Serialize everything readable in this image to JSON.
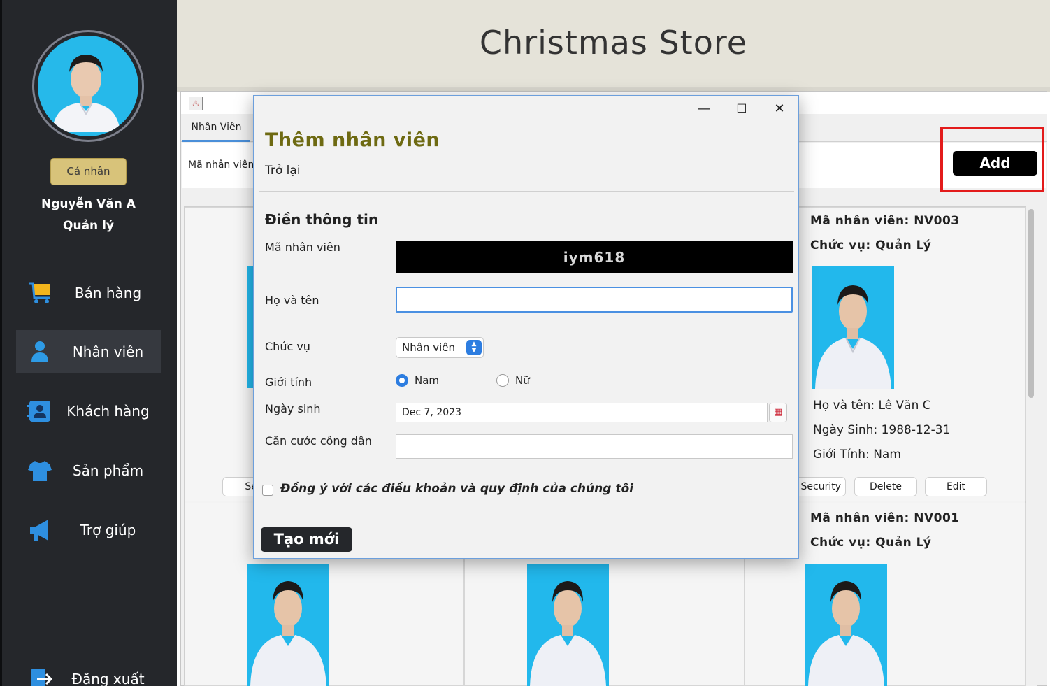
{
  "header": {
    "title": "Christmas Store"
  },
  "sidebar": {
    "profile_button": "Cá nhân",
    "user_name": "Nguyễn Văn A",
    "user_role": "Quản lý",
    "items": [
      {
        "label": "Bán hàng",
        "icon": "cart-icon"
      },
      {
        "label": "Nhân viên",
        "icon": "person-icon"
      },
      {
        "label": "Khách hàng",
        "icon": "contacts-icon"
      },
      {
        "label": "Sản phẩm",
        "icon": "shirt-icon"
      },
      {
        "label": "Trợ giúp",
        "icon": "megaphone-icon"
      },
      {
        "label": "Đăng xuất",
        "icon": "logout-icon"
      }
    ],
    "active_item": "Nhân viên"
  },
  "main": {
    "tab": "Nhân Viên",
    "search_label": "Mã nhân viên",
    "add_button": "Add"
  },
  "cards": [
    {
      "id_line": "Mã nhân viên: NV003",
      "role_line": "Chức vụ: Quản Lý",
      "name_line": "Họ và tên: Lê Văn C",
      "dob_line": "Ngày Sinh: 1988-12-31",
      "gender_line": "Giới Tính: Nam",
      "security_button": "Security",
      "delete_button": "Delete",
      "edit_button": "Edit"
    },
    {
      "id_line": "Mã nhân viên: NV001",
      "role_line": "Chức vụ: Quản Lý"
    },
    {
      "security_button_partial": "Sec"
    }
  ],
  "dialog": {
    "title": "Thêm nhân viên",
    "back_link": "Trở lại",
    "section_title": "Điền thông tin",
    "fields": {
      "code_label": "Mã nhân viên",
      "code_value": "iym618",
      "name_label": "Họ và tên",
      "name_value": "",
      "role_label": "Chức vụ",
      "role_value": "Nhân viên",
      "gender_label": "Giới tính",
      "gender_male": "Nam",
      "gender_female": "Nữ",
      "gender_selected": "Nam",
      "dob_label": "Ngày sinh",
      "dob_value": "Dec 7, 2023",
      "id_card_label": "Căn cước công dân",
      "id_card_value": ""
    },
    "agree_text": "Đồng ý với các điều khoản và quy định của chúng tôi",
    "agree_checked": false,
    "submit_button": "Tạo mới",
    "window_controls": {
      "minimize": "—",
      "maximize": "☐",
      "close": "✕"
    }
  },
  "colors": {
    "sidebar_bg": "#25272b",
    "header_bg": "#e5e3d9",
    "accent_blue": "#2d7de0",
    "dialog_title": "#6e6a12",
    "highlight_red": "#e31b1b",
    "profile_button": "#d8c37a"
  }
}
